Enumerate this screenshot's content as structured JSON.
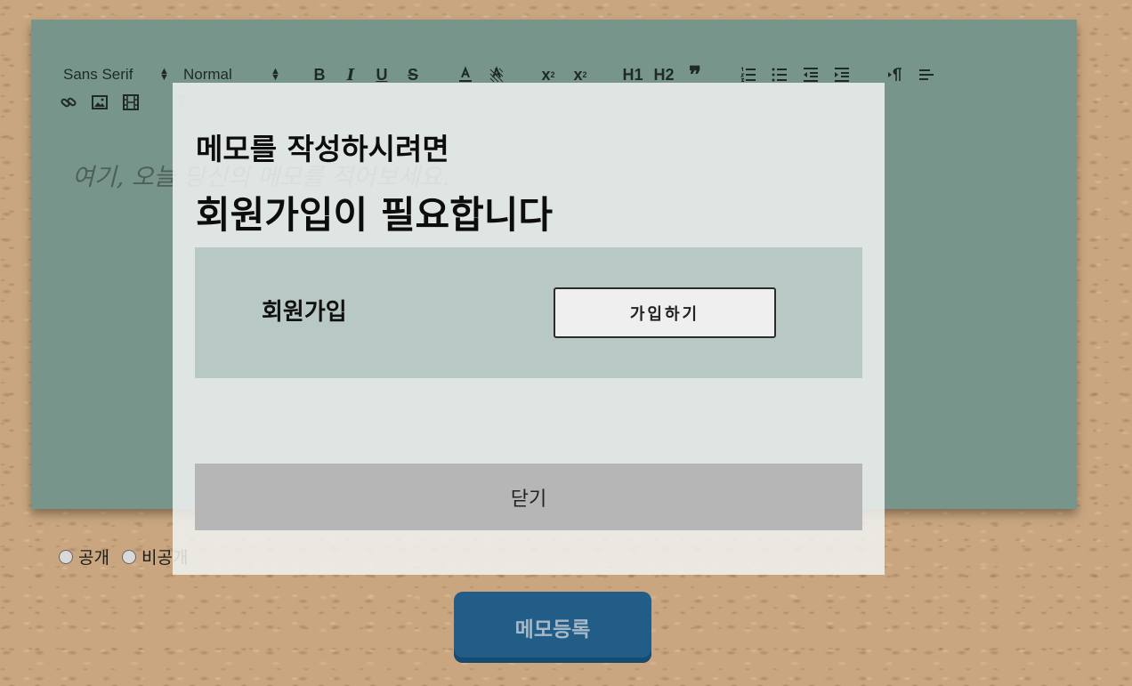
{
  "editor": {
    "font_picker": "Sans Serif",
    "size_picker": "Normal",
    "placeholder": "여기, 오늘 당신의 메모를 적어보세요.",
    "toolbar": {
      "bold": "B",
      "italic": "I",
      "underline": "U",
      "strike": "S",
      "subscript": "x",
      "subscript_sub": "2",
      "superscript": "x",
      "superscript_sup": "2",
      "h1": "H1",
      "h2": "H2",
      "blockquote": "❞"
    }
  },
  "visibility": {
    "options": [
      "공개",
      "비공개"
    ]
  },
  "submit_label": "메모등록",
  "modal": {
    "title_line1": "메모를 작성하시려면",
    "title_line2": "회원가입이 필요합니다",
    "signup_label": "회원가입",
    "join_button": "가입하기",
    "close_button": "닫기"
  }
}
